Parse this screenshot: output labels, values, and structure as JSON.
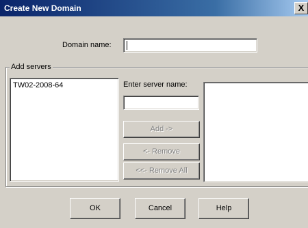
{
  "window": {
    "title": "Create New Domain",
    "close_glyph": "X"
  },
  "domain": {
    "label": "Domain name:",
    "value": ""
  },
  "add_servers": {
    "group_title": "Add servers",
    "available_servers": [
      "TW02-2008-64"
    ],
    "enter_server_label": "Enter server name:",
    "server_name_value": "",
    "add_label": "Add ->",
    "remove_label": "<- Remove",
    "remove_all_label": "<<- Remove All",
    "selected_servers": []
  },
  "footer": {
    "ok_label": "OK",
    "cancel_label": "Cancel",
    "help_label": "Help"
  }
}
